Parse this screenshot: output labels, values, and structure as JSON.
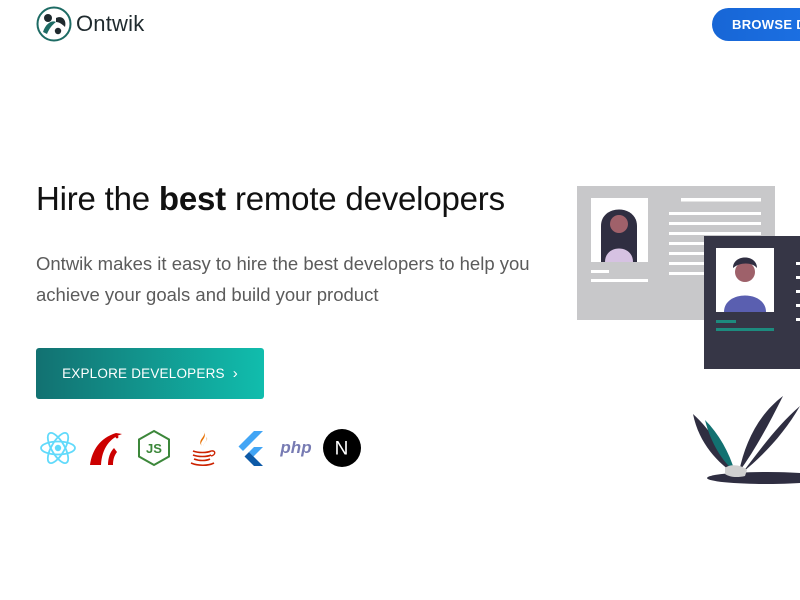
{
  "header": {
    "brand": "Ontwik",
    "browse_button": "BROWSE DEVELOPERS"
  },
  "hero": {
    "title_part1": "Hire the ",
    "title_strong": "best",
    "title_part2": " remote developers",
    "subtitle": "Ontwik makes it easy to hire the best developers to help you achieve your goals and build your product",
    "cta_label": "EXPLORE DEVELOPERS"
  },
  "tech_logos": {
    "php_label": "php",
    "next_letter": "N",
    "react_color": "#61dafb",
    "rails_color": "#cc0000",
    "node_color": "#3c873a",
    "flutter_color": "#42a5f5",
    "php_color": "#777bb3"
  },
  "colors": {
    "accent_gradient_start": "#127171",
    "accent_gradient_end": "#11bdad",
    "browse_blue": "#1766d6"
  }
}
